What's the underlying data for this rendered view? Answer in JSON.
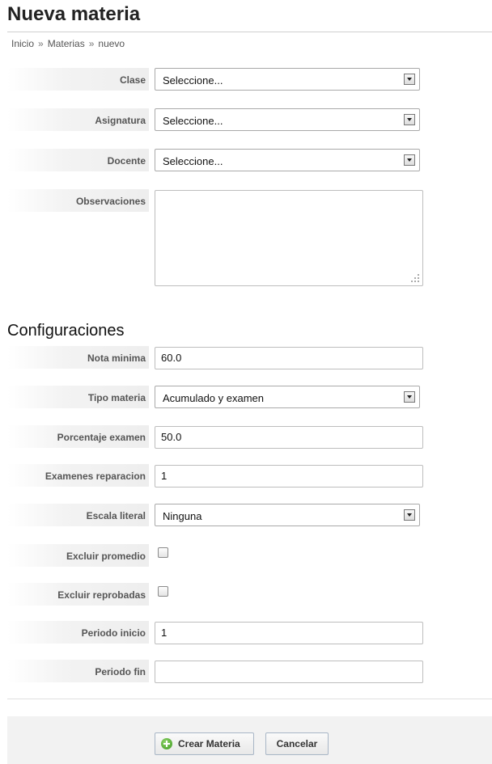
{
  "page": {
    "title": "Nueva materia",
    "breadcrumb": [
      "Inicio",
      "Materias",
      "nuevo"
    ],
    "breadcrumb_separator": "»"
  },
  "form": {
    "clase": {
      "label": "Clase",
      "value": "Seleccione..."
    },
    "asignatura": {
      "label": "Asignatura",
      "value": "Seleccione..."
    },
    "docente": {
      "label": "Docente",
      "value": "Seleccione..."
    },
    "observaciones": {
      "label": "Observaciones",
      "value": ""
    }
  },
  "config": {
    "title": "Configuraciones",
    "nota_minima": {
      "label": "Nota minima",
      "value": "60.0"
    },
    "tipo_materia": {
      "label": "Tipo materia",
      "value": "Acumulado y examen"
    },
    "porcentaje_examen": {
      "label": "Porcentaje examen",
      "value": "50.0"
    },
    "examenes_reparacion": {
      "label": "Examenes reparacion",
      "value": "1"
    },
    "escala_literal": {
      "label": "Escala literal",
      "value": "Ninguna"
    },
    "excluir_promedio": {
      "label": "Excluir promedio",
      "checked": false
    },
    "excluir_reprobadas": {
      "label": "Excluir reprobadas",
      "checked": false
    },
    "periodo_inicio": {
      "label": "Periodo inicio",
      "value": "1"
    },
    "periodo_fin": {
      "label": "Periodo fin",
      "value": ""
    }
  },
  "actions": {
    "create_label": "Crear Materia",
    "create_icon": "add-circle-icon",
    "cancel_label": "Cancelar"
  },
  "colors": {
    "label_text": "#555555",
    "create_icon": "#3d9a1f"
  }
}
